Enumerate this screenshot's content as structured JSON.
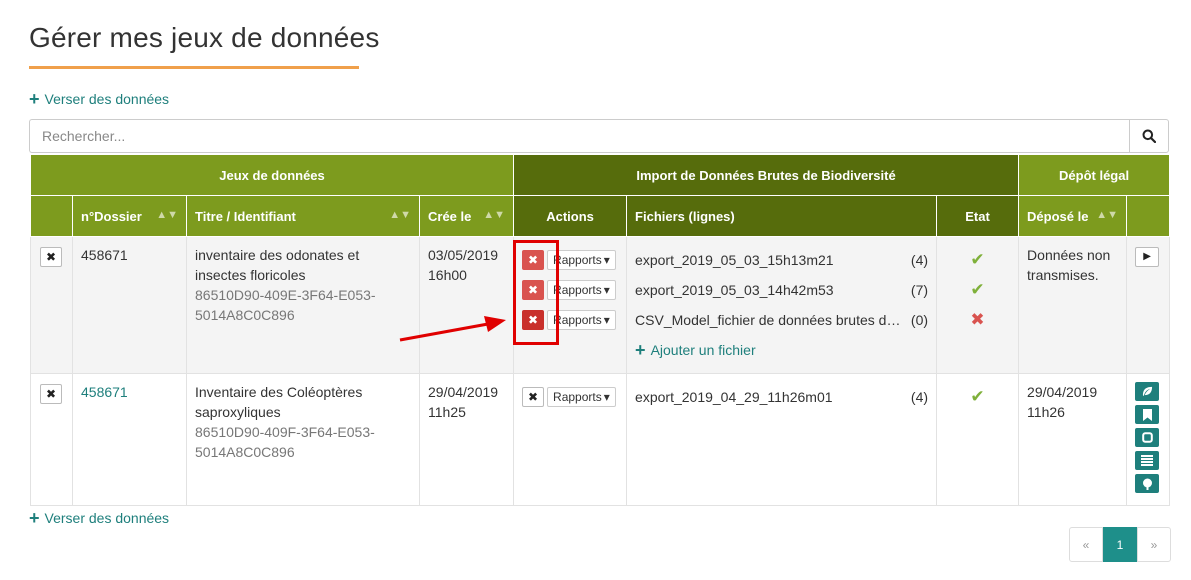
{
  "page": {
    "title": "Gérer mes jeux de données"
  },
  "actions": {
    "add_data_label": "Verser des données",
    "add_data_label_bottom": "Verser des données"
  },
  "search": {
    "placeholder": "Rechercher..."
  },
  "table": {
    "group_headers": [
      "Jeux de données",
      "Import de Données Brutes de Biodiversité",
      "Dépôt légal"
    ],
    "columns": {
      "dossier": "n°Dossier",
      "title": "Titre / Identifiant",
      "created": "Crée le",
      "actions": "Actions",
      "files": "Fichiers (lignes)",
      "state": "Etat",
      "deposited": "Déposé le"
    },
    "rows": [
      {
        "dossier": "458671",
        "title": "inventaire des odonates et insectes floricoles",
        "uuid": "86510D90-409E-3F64-E053-5014A8C0C896",
        "created": "03/05/2019 16h00",
        "reports_label": "Rapports",
        "files": [
          {
            "name": "export_2019_05_03_15h13m21",
            "count": "(4)",
            "state": "ok"
          },
          {
            "name": "export_2019_05_03_14h42m53",
            "count": "(7)",
            "state": "ok"
          },
          {
            "name": "CSV_Model_fichier de données brutes de biodiversité",
            "count": "(0)",
            "state": "error"
          }
        ],
        "add_file_label": "Ajouter un fichier",
        "deposited": "Données non transmises."
      },
      {
        "dossier": "458671",
        "title": "Inventaire des Coléoptères saproxyliques",
        "uuid": "86510D90-409F-3F64-E053-5014A8C0C896",
        "created": "29/04/2019 11h25",
        "reports_label": "Rapports",
        "files": [
          {
            "name": "export_2019_04_29_11h26m01",
            "count": "(4)",
            "state": "ok"
          }
        ],
        "deposited": "29/04/2019 11h26"
      }
    ]
  },
  "pagination": {
    "prev": "«",
    "current": "1",
    "next": "»"
  },
  "colors": {
    "header_light": "#7d9b1e",
    "header_dark": "#566c0c",
    "accent_teal": "#1e7f7c",
    "title_underline": "#f0a04b",
    "danger": "#d9534f",
    "success": "#7fb03a"
  },
  "icons": {
    "add": "plus-icon",
    "search": "search-icon",
    "delete": "times-icon",
    "play": "play-icon",
    "leaf": "leaf-icon",
    "bookmark": "bookmark-icon",
    "square": "square-icon",
    "list": "list-icon",
    "tree": "tree-icon"
  }
}
